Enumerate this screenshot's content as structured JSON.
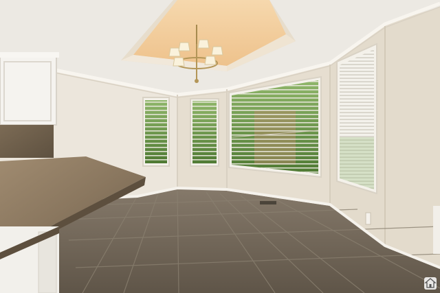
{
  "scene": {
    "description_hidden": "",
    "palette": {
      "ceiling": "#ece9e3",
      "tray": "#f3cf9e",
      "wall_left": "#ece6dc",
      "wall_back": "#e8e0d2",
      "wall_right": "#e2dacb",
      "trim": "#f7f4ee",
      "floor": "#6e6456",
      "grout": "#8a8070",
      "counter": "#8d7a63",
      "cabinet": "#f5f3ef",
      "foliage": "#5c8a3a"
    },
    "icons": [
      "chandelier-icon",
      "home-badge-icon"
    ]
  }
}
